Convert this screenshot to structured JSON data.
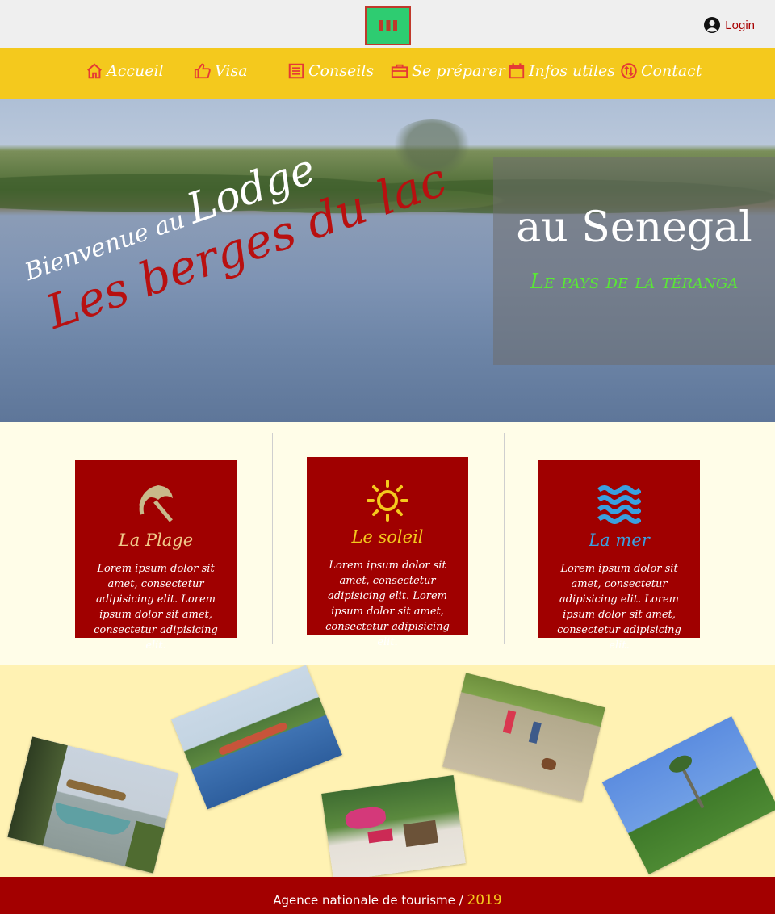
{
  "topbar": {
    "menu_icon": "hamburger-icon",
    "login_label": "Login",
    "login_icon": "user-circle-icon"
  },
  "nav": {
    "items": [
      {
        "label": "Accueil",
        "icon": "home-icon"
      },
      {
        "label": "Visa",
        "icon": "thumbs-up-icon"
      },
      {
        "label": "Conseils",
        "icon": "list-icon"
      },
      {
        "label": "Se préparer",
        "icon": "briefcase-icon"
      },
      {
        "label": "Infos utiles",
        "icon": "calendar-icon"
      },
      {
        "label": "Contact",
        "icon": "exchange-icon"
      }
    ]
  },
  "hero": {
    "welcome_prefix": "Bienvenue au",
    "welcome_word": "Lodge",
    "lodge_name": "Les berges du lac",
    "country": "au Senegal",
    "slogan": "Le pays de la téranga"
  },
  "features": [
    {
      "title": "La Plage",
      "icon": "beach-umbrella-icon",
      "title_color": "#f0c98a",
      "text": "Lorem ipsum dolor sit amet, consectetur adipisicing elit. Lorem ipsum dolor sit amet, consectetur adipisicing elit."
    },
    {
      "title": "Le soleil",
      "icon": "sun-icon",
      "title_color": "#f4c91d",
      "text": "Lorem ipsum dolor sit amet, consectetur adipisicing elit. Lorem ipsum dolor sit amet, consectetur adipisicing elit."
    },
    {
      "title": "La mer",
      "icon": "waves-icon",
      "title_color": "#3aa0e0",
      "text": "Lorem ipsum dolor sit amet, consectetur adipisicing elit. Lorem ipsum dolor sit amet, consectetur adipisicing elit."
    }
  ],
  "gallery": {
    "photos": [
      "boat-photo",
      "island-photo",
      "terrace-photo",
      "kids-dog-photo",
      "palm-tree-photo"
    ]
  },
  "footer": {
    "agency": "Agence nationale de tourisme /",
    "year": "2019"
  },
  "colors": {
    "nav_bg": "#f4c91d",
    "brand_red": "#a00000",
    "menu_btn": "#2ecc71",
    "slogan_green": "#59e835"
  }
}
